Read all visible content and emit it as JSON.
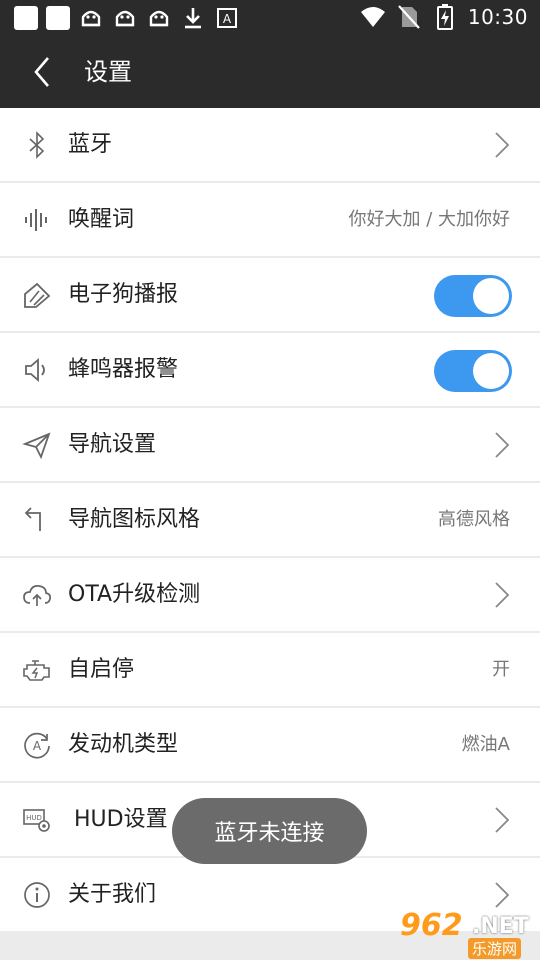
{
  "status_bar": {
    "time": "10:30",
    "icons": [
      "app-square",
      "app-square",
      "android-bug",
      "android-bug",
      "android-bug",
      "download-arrow",
      "keyboard-a",
      "wifi",
      "no-sim",
      "battery-charging"
    ]
  },
  "app_bar": {
    "title": "设置"
  },
  "settings": {
    "bluetooth": {
      "label": "蓝牙",
      "icon": "bluetooth-icon"
    },
    "wake_word": {
      "label": "唤醒词",
      "value": "你好大加 / 大加你好",
      "icon": "voice-wave-icon"
    },
    "speed_camera": {
      "label": "电子狗播报",
      "toggle_on": true,
      "icon": "camera-radar-icon"
    },
    "buzzer": {
      "label": "蜂鸣器报警",
      "toggle_on": true,
      "icon": "speaker-icon"
    },
    "nav_settings": {
      "label": "导航设置",
      "icon": "paper-plane-icon"
    },
    "nav_icon_style": {
      "label": "导航图标风格",
      "value": "高德风格",
      "icon": "turn-arrow-icon"
    },
    "ota": {
      "label": "OTA升级检测",
      "icon": "cloud-upload-icon"
    },
    "auto_start_stop": {
      "label": "自启停",
      "value": "开",
      "icon": "engine-icon"
    },
    "engine_type": {
      "label": "发动机类型",
      "value": "燃油A",
      "icon": "auto-a-icon"
    },
    "hud": {
      "label": "HUD设置",
      "icon": "hud-gear-icon"
    },
    "about": {
      "label": "关于我们",
      "icon": "info-icon"
    }
  },
  "toast": {
    "text": "蓝牙未连接"
  },
  "watermark": {
    "brand": "962",
    "net": ".NET",
    "sub": "乐游网"
  },
  "colors": {
    "bar": "#2b2b2b",
    "toggle": "#3d98ef",
    "toast": "#6b6b6b",
    "watermark": "#ff9a1a"
  }
}
